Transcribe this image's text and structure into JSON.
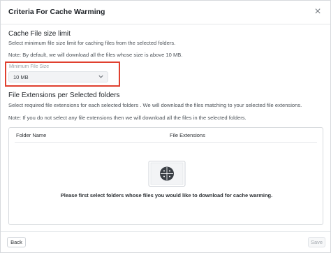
{
  "dialog": {
    "title": "Criteria For Cache Warming",
    "close_glyph": "×"
  },
  "file_size": {
    "heading": "Cache File size limit",
    "description": "Select minimum file size limit for caching files from the selected folders.",
    "note": "Note: By default, we will download all the files whose size is above 10 MB.",
    "field_label": "Minimum File Size",
    "selected_value": "10 MB",
    "highlight_color": "#e0402f"
  },
  "extensions": {
    "heading": "File Extensions per Selected folders",
    "description": "Select required file extensions for each selected folders . We will download the files matching to your selected file extensions.",
    "note": "Note: If you do not select any file extensions then we will download all the files in the selected folders.",
    "table": {
      "columns": [
        "Folder Name",
        "File Extensions"
      ],
      "empty_message": "Please first select folders whose files you would like to download for cache warming."
    }
  },
  "footer": {
    "back_label": "Back",
    "save_label": "Save",
    "save_enabled": false
  }
}
